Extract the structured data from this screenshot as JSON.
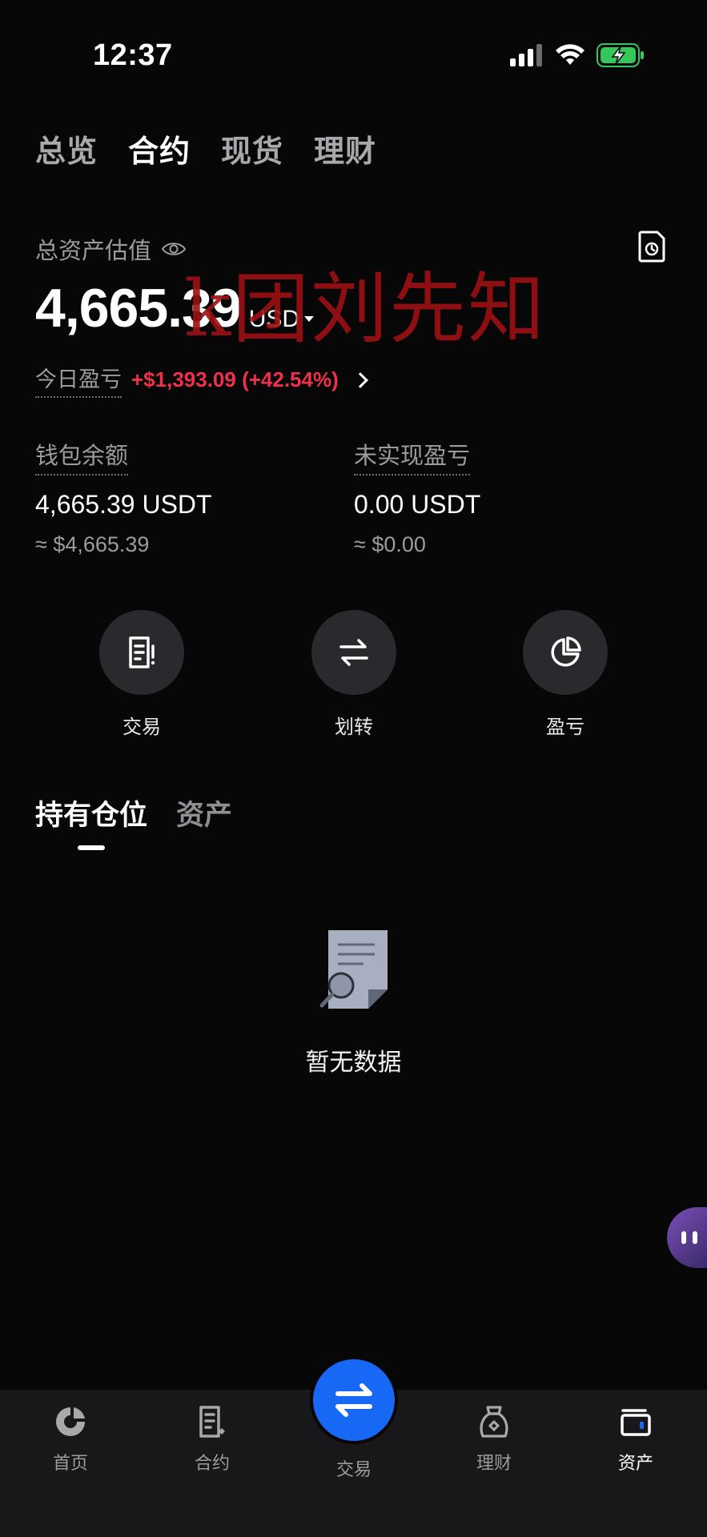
{
  "status_bar": {
    "time": "12:37"
  },
  "top_tabs": [
    {
      "label": "总览",
      "active": false
    },
    {
      "label": "合约",
      "active": true
    },
    {
      "label": "现货",
      "active": false
    },
    {
      "label": "理财",
      "active": false
    }
  ],
  "asset": {
    "label": "总资产估值",
    "total_value": "4,665.39",
    "unit": "USD",
    "today_pnl_label": "今日盈亏",
    "today_pnl_value": "+$1,393.09 (+42.54%)"
  },
  "watermark": "k团刘先知",
  "wallet": {
    "label": "钱包余额",
    "value": "4,665.39 USDT",
    "approx": "≈ $4,665.39"
  },
  "unrealized": {
    "label": "未实现盈亏",
    "value": "0.00 USDT",
    "approx": "≈ $0.00"
  },
  "actions": [
    {
      "label": "交易",
      "icon": "order-icon"
    },
    {
      "label": "划转",
      "icon": "transfer-icon"
    },
    {
      "label": "盈亏",
      "icon": "pie-chart-icon"
    }
  ],
  "section_tabs": [
    {
      "label": "持有仓位",
      "active": true
    },
    {
      "label": "资产",
      "active": false
    }
  ],
  "empty_state": {
    "text": "暂无数据"
  },
  "bottom_nav": [
    {
      "label": "首页",
      "icon": "home-icon",
      "active": false
    },
    {
      "label": "合约",
      "icon": "contract-icon",
      "active": false
    },
    {
      "label": "交易",
      "icon": "trade-icon",
      "active": false
    },
    {
      "label": "理财",
      "icon": "finance-icon",
      "active": false
    },
    {
      "label": "资产",
      "icon": "wallet-icon",
      "active": true
    }
  ],
  "colors": {
    "background": "#070708",
    "accent_blue": "#1668f5",
    "loss_red": "#f0304a",
    "battery_green": "#34c759"
  }
}
